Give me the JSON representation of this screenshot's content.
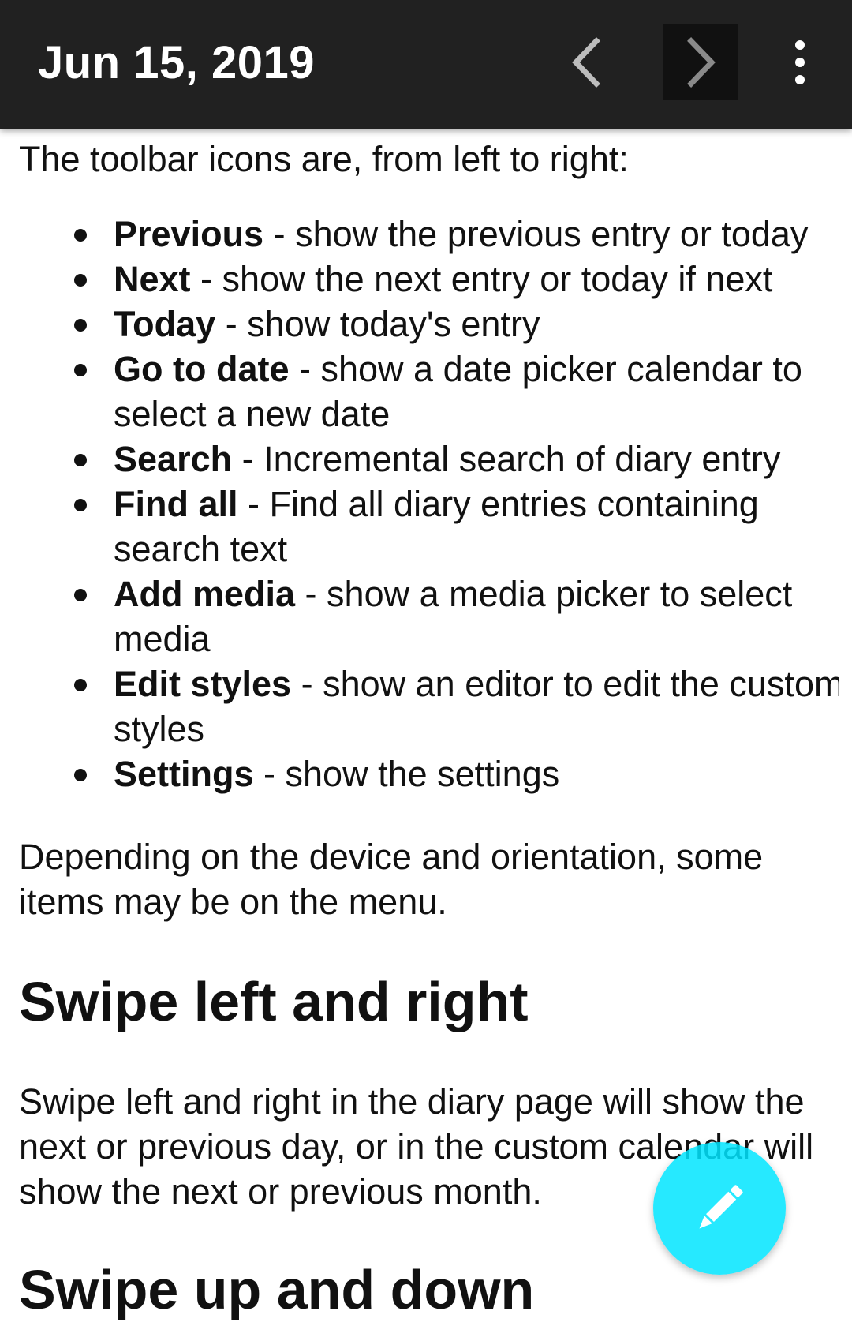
{
  "toolbar": {
    "title": "Jun 15, 2019",
    "previous_icon": "chevron-left-icon",
    "next_icon": "chevron-right-icon",
    "menu_icon": "more-vertical-icon",
    "background_color": "#212121"
  },
  "content": {
    "intro": "The toolbar icons are, from left to right:",
    "items": [
      {
        "term": "Previous",
        "desc": " - show the previous entry or today"
      },
      {
        "term": "Next",
        "desc": " - show the next entry or today if next"
      },
      {
        "term": "Today",
        "desc": " - show today's entry"
      },
      {
        "term": "Go to date",
        "desc": " - show a date picker calendar to select a new date"
      },
      {
        "term": "Search",
        "desc": " - Incremental search of diary entry"
      },
      {
        "term": "Find all",
        "desc": " - Find all diary entries containing search text"
      },
      {
        "term": "Add media",
        "desc": " - show a media picker to select media"
      },
      {
        "term": "Edit styles",
        "desc": " - show an editor to edit the custom styles"
      },
      {
        "term": "Settings",
        "desc": " - show the settings"
      }
    ],
    "menu_note": "Depending on the device and orientation, some items may be on the menu.",
    "swipe_heading": "Swipe left and right",
    "swipe_text": "Swipe left and right in the diary page will show the next or previous day, or in the custom calendar will show the next or previous month.",
    "next_heading": "Swipe up and down"
  },
  "fab": {
    "icon": "pencil-icon",
    "color": "#00e5ff"
  }
}
